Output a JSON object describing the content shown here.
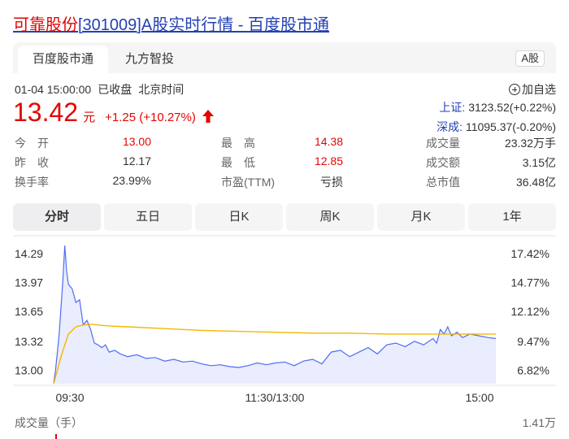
{
  "title": {
    "name": "可靠股份",
    "code": "[301009]",
    "rest": "A股实时行情 - 百度股市通"
  },
  "source_tabs": [
    {
      "label": "百度股市通"
    },
    {
      "label": "九方智投"
    }
  ],
  "market_badge": "A股",
  "info": {
    "datetime": "01-04 15:00:00",
    "status": "已收盘",
    "timezone": "北京时间"
  },
  "price": {
    "value": "13.42",
    "unit": "元",
    "change": "+1.25 (+10.27%)"
  },
  "add_watchlist": "加自选",
  "indices": [
    {
      "label": "上证:",
      "value": "3123.52(+0.22%)"
    },
    {
      "label": "深成:",
      "value": "11095.37(-0.20%)"
    }
  ],
  "stats": [
    {
      "label": "今　开",
      "value": "13.00"
    },
    {
      "label": "最　高",
      "value": "14.38"
    },
    {
      "label": "成交量",
      "value": "23.32万手"
    },
    {
      "label": "昨　收",
      "value": "12.17"
    },
    {
      "label": "最　低",
      "value": "12.85"
    },
    {
      "label": "成交额",
      "value": "3.15亿"
    },
    {
      "label": "换手率",
      "value": "23.99%"
    },
    {
      "label": "市盈(TTM)",
      "value": "亏损"
    },
    {
      "label": "总市值",
      "value": "36.48亿"
    }
  ],
  "period_tabs": [
    "分时",
    "五日",
    "日K",
    "周K",
    "月K",
    "1年"
  ],
  "volume": {
    "label": "成交量（手）",
    "max": "1.41万"
  },
  "colors": {
    "up": "#e10602",
    "link": "#2440b3",
    "price_line": "#4e6ef2",
    "avg_line": "#f5b800"
  },
  "chart_data": {
    "type": "line",
    "y_ticks": [
      "14.29",
      "13.97",
      "13.65",
      "13.32",
      "13.00"
    ],
    "y_right_ticks": [
      "17.42%",
      "14.77%",
      "12.12%",
      "9.47%",
      "6.82%"
    ],
    "x_ticks": [
      "09:30",
      "11:30/13:00",
      "15:00"
    ],
    "ylim": [
      12.85,
      14.38
    ],
    "x_count": 240,
    "series": [
      {
        "x": [
          0,
          1,
          2,
          3,
          4,
          5,
          6,
          7,
          8,
          10,
          12,
          14,
          16,
          18,
          20,
          22,
          24,
          26,
          28,
          30,
          33,
          36,
          40,
          45,
          50,
          55,
          60,
          65,
          70,
          75,
          80,
          85,
          90,
          95,
          100,
          105,
          110,
          115,
          120,
          125,
          130,
          135,
          140,
          145,
          150,
          155,
          160,
          165,
          170,
          175,
          180,
          185,
          190,
          195,
          200,
          205,
          207,
          209,
          211,
          213,
          215,
          218,
          221,
          225,
          230,
          235,
          239
        ],
        "values": [
          12.85,
          13.0,
          13.2,
          13.4,
          13.7,
          14.0,
          14.38,
          14.1,
          13.95,
          13.9,
          13.75,
          13.78,
          13.5,
          13.55,
          13.45,
          13.3,
          13.28,
          13.25,
          13.28,
          13.2,
          13.22,
          13.18,
          13.15,
          13.17,
          13.13,
          13.14,
          13.1,
          13.12,
          13.09,
          13.1,
          13.07,
          13.05,
          13.06,
          13.04,
          13.03,
          13.05,
          13.08,
          13.06,
          13.08,
          13.09,
          13.05,
          13.1,
          13.12,
          13.07,
          13.2,
          13.22,
          13.15,
          13.2,
          13.25,
          13.18,
          13.28,
          13.3,
          13.26,
          13.32,
          13.28,
          13.35,
          13.3,
          13.45,
          13.4,
          13.48,
          13.38,
          13.42,
          13.36,
          13.4,
          13.38,
          13.36,
          13.35
        ]
      },
      {
        "x": [
          0,
          2,
          4,
          6,
          8,
          12,
          16,
          20,
          24,
          30,
          40,
          60,
          80,
          100,
          120,
          140,
          160,
          180,
          200,
          220,
          239
        ],
        "values": [
          12.85,
          13.0,
          13.15,
          13.28,
          13.4,
          13.48,
          13.5,
          13.51,
          13.5,
          13.49,
          13.48,
          13.46,
          13.44,
          13.43,
          13.42,
          13.41,
          13.41,
          13.4,
          13.4,
          13.4,
          13.4
        ]
      }
    ]
  }
}
